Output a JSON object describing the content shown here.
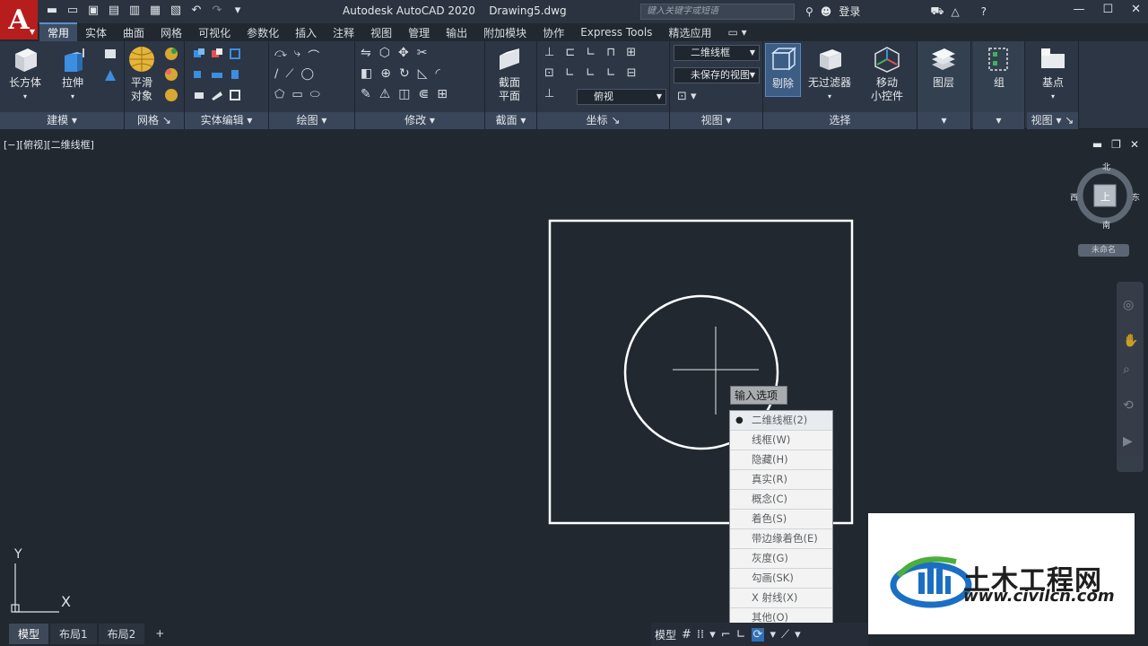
{
  "app": {
    "title": "Autodesk AutoCAD 2020",
    "filename": "Drawing5.dwg",
    "logo_letter": "A"
  },
  "search": {
    "placeholder": "键入关键字或短语"
  },
  "account": {
    "login_label": "登录"
  },
  "ribbon_tabs": [
    "常用",
    "实体",
    "曲面",
    "网格",
    "可视化",
    "参数化",
    "插入",
    "注释",
    "视图",
    "管理",
    "输出",
    "附加模块",
    "协作",
    "Express Tools",
    "精选应用"
  ],
  "ribbon_panels": {
    "modeling": {
      "title": "建模",
      "box_label": "长方体",
      "extrude_label": "拉伸"
    },
    "mesh": {
      "title": "网格",
      "smooth_label_1": "平滑",
      "smooth_label_2": "对象"
    },
    "solid_edit": {
      "title": "实体编辑"
    },
    "draw": {
      "title": "绘图"
    },
    "modify": {
      "title": "修改"
    },
    "section": {
      "title": "截面",
      "plane_label_1": "截面",
      "plane_label_2": "平面"
    },
    "coordinates": {
      "title": "坐标",
      "view_dropdown": "俯视"
    },
    "view": {
      "title": "视图",
      "visual_style": "二维线框",
      "saved_view": "未保存的视图"
    },
    "selection": {
      "title": "选择",
      "culling_label": "剔除",
      "nofilter_label": "无过滤器",
      "gizmo_label_1": "移动",
      "gizmo_label_2": "小控件"
    },
    "layers": {
      "title": "图层"
    },
    "groups": {
      "title": "组"
    },
    "view2": {
      "title": "视图",
      "basepoint_label": "基点"
    }
  },
  "viewport": {
    "label": "[−][俯视][二维线框]",
    "viewcube": {
      "north": "北",
      "south": "南",
      "east": "东",
      "west": "西",
      "face": "上"
    },
    "unnamed_ucs": "未命名"
  },
  "context_menu": {
    "tooltip": "输入选项",
    "items": [
      {
        "label": "二维线框(2)",
        "selected": true
      },
      {
        "label": "线框(W)",
        "selected": false
      },
      {
        "label": "隐藏(H)",
        "selected": false
      },
      {
        "label": "真实(R)",
        "selected": false
      },
      {
        "label": "概念(C)",
        "selected": false
      },
      {
        "label": "着色(S)",
        "selected": false
      },
      {
        "label": "带边缘着色(E)",
        "selected": false
      },
      {
        "label": "灰度(G)",
        "selected": false
      },
      {
        "label": "勾画(SK)",
        "selected": false
      },
      {
        "label": "X 射线(X)",
        "selected": false
      },
      {
        "label": "其他(O)",
        "selected": false
      }
    ]
  },
  "ucs": {
    "y_label": "Y",
    "x_label": "X"
  },
  "layout_tabs": [
    "模型",
    "布局1",
    "布局2",
    "+"
  ],
  "status_bar": {
    "model_label": "模型"
  },
  "watermark": {
    "title": "土木工程网",
    "url": "www.civilcn.com"
  },
  "colors": {
    "background": "#212830",
    "logo_red": "#b81d1d",
    "ribbon": "#2d3645",
    "accent_blue": "#1a6fc4"
  }
}
